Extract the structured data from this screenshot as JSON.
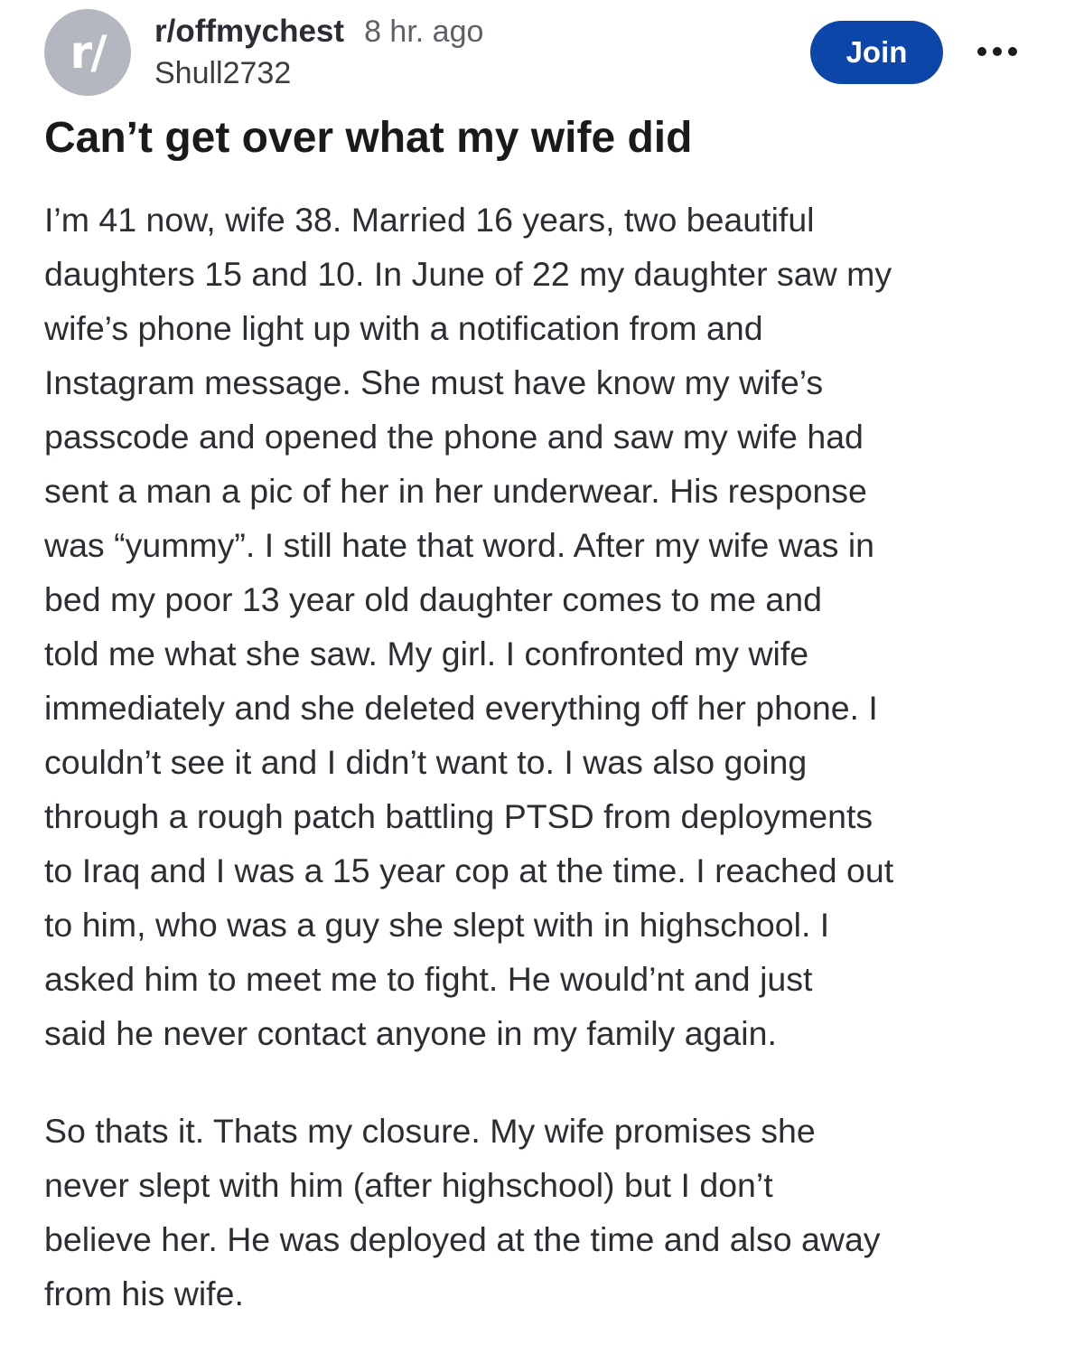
{
  "post": {
    "avatar_text": "r/",
    "subreddit": "r/offmychest",
    "time": "8 hr. ago",
    "author": "Shull2732",
    "join_label": "Join",
    "more_icon": "more-horizontal-icon",
    "title": "Can’t get over what my wife did",
    "paragraphs": [
      [
        "I’m 41 now, wife 38. Married 16 years, two beautiful",
        "daughters 15 and 10. In June of 22 my daughter saw my",
        "wife’s phone light up with a notification from and",
        "Instagram message. She must have know my wife’s",
        "passcode and opened the phone and saw my wife had",
        "sent a man a pic of her in her underwear. His response",
        "was “yummy”. I still hate that word. After my wife was in",
        "bed my poor 13 year old daughter comes to me and",
        "told me what she saw. My girl. I confronted my wife",
        "immediately and she deleted everything off her phone. I",
        "couldn’t see it and I didn’t want to. I was also going",
        "through a rough patch battling PTSD from deployments",
        "to Iraq and I was a 15 year cop at the time. I reached out",
        "to him, who was a guy she slept with in highschool. I",
        "asked him to meet me to fight. He would’nt and just",
        "said he never contact anyone in my family again."
      ],
      [
        "So thats it. Thats my closure. My wife promises she",
        "never slept with him (after highschool) but I don’t",
        "believe her. He was deployed at the time and also away",
        "from his wife."
      ]
    ]
  }
}
